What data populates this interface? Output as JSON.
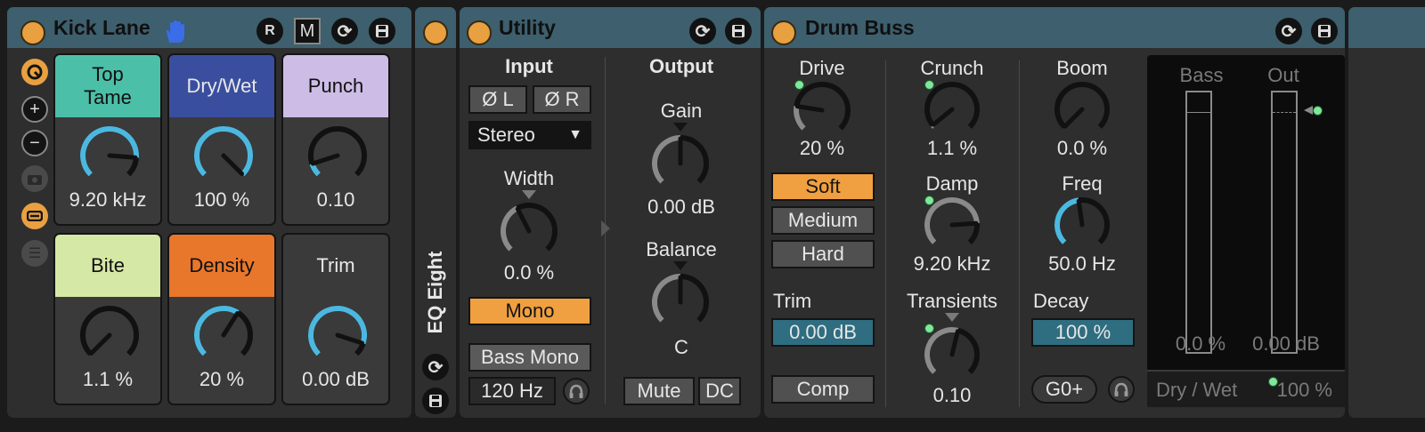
{
  "kick_lane": {
    "title": "Kick Lane",
    "buttons": {
      "r": "R",
      "m": "M"
    },
    "macros": [
      {
        "label": "Top\nTame",
        "value": "9.20 kHz",
        "color": "#4cbfa8",
        "text": "#101010"
      },
      {
        "label": "Dry/Wet",
        "value": "100 %",
        "color": "#3a4ea0",
        "text": "#e8e8e8"
      },
      {
        "label": "Punch",
        "value": "0.10",
        "color": "#cdbde6",
        "text": "#101010"
      },
      {
        "label": "Bite",
        "value": "1.1 %",
        "color": "#d6e8a6",
        "text": "#101010"
      },
      {
        "label": "Density",
        "value": "20 %",
        "color": "#e8772c",
        "text": "#101010"
      },
      {
        "label": "Trim",
        "value": "0.00 dB",
        "color": "#3a3a3a",
        "text": "#e8e8e8"
      }
    ]
  },
  "eq_eight": {
    "title": "EQ Eight"
  },
  "utility": {
    "title": "Utility",
    "input_label": "Input",
    "output_label": "Output",
    "phase_left": "Ø L",
    "phase_right": "Ø R",
    "channel_mode": "Stereo",
    "width_label": "Width",
    "width_value": "0.0 %",
    "mono_label": "Mono",
    "bass_mono_label": "Bass Mono",
    "bass_mono_freq": "120 Hz",
    "gain_label": "Gain",
    "gain_value": "0.00 dB",
    "balance_label": "Balance",
    "balance_value": "C",
    "mute_label": "Mute",
    "dc_label": "DC"
  },
  "drum_buss": {
    "title": "Drum Buss",
    "drive_label": "Drive",
    "drive_value": "20 %",
    "drive_types": [
      "Soft",
      "Medium",
      "Hard"
    ],
    "trim_label": "Trim",
    "trim_value": "0.00 dB",
    "comp_label": "Comp",
    "crunch_label": "Crunch",
    "crunch_value": "1.1 %",
    "damp_label": "Damp",
    "damp_value": "9.20 kHz",
    "transients_label": "Transients",
    "transients_value": "0.10",
    "boom_label": "Boom",
    "boom_value": "0.0 %",
    "freq_label": "Freq",
    "freq_value": "50.0 Hz",
    "decay_label": "Decay",
    "decay_value": "100 %",
    "boom_audition": "G0+",
    "bass_meter_label": "Bass",
    "bass_meter_value": "0.0 %",
    "out_meter_label": "Out",
    "out_meter_value": "0.00 dB",
    "dry_wet_label": "Dry / Wet",
    "dry_wet_value": "100 %"
  },
  "colors": {
    "accent_orange": "#e8a040",
    "header": "#3d5f6e",
    "knob_arc": "#4cb8e0",
    "led": "#7fe89a"
  }
}
